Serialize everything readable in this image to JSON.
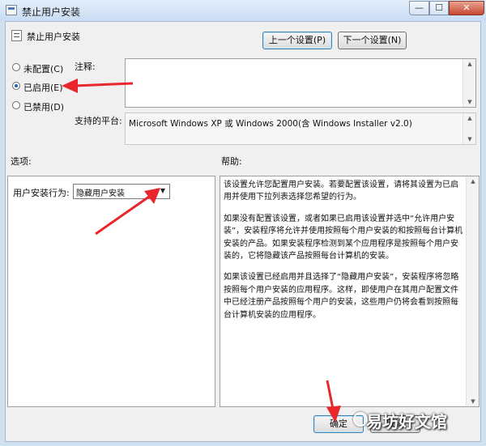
{
  "window": {
    "title": "禁止用户安装",
    "min_label": "—",
    "max_label": "☐",
    "close_label": "✕"
  },
  "header": {
    "policy_name": "禁止用户安装"
  },
  "nav": {
    "prev_label": "上一个设置(P)",
    "next_label": "下一个设置(N)"
  },
  "radios": [
    {
      "label": "未配置(C)",
      "selected": false
    },
    {
      "label": "已启用(E)",
      "selected": true
    },
    {
      "label": "已禁用(D)",
      "selected": false
    }
  ],
  "comment": {
    "label": "注释:",
    "value": ""
  },
  "platform": {
    "label": "支持的平台:",
    "value": "Microsoft Windows XP 或 Windows 2000(含 Windows Installer v2.0)"
  },
  "options": {
    "label": "选项:",
    "behavior_label": "用户安装行为:",
    "behavior_value": "隐藏用户安装"
  },
  "help": {
    "label": "帮助:",
    "paragraphs": [
      "该设置允许您配置用户安装。若要配置该设置，请将其设置为已启用并使用下拉列表选择您希望的行为。",
      "如果没有配置该设置，或者如果已启用该设置并选中“允许用户安装”，安装程序将允许并使用按照每个用户安装的和按照每台计算机安装的产品。如果安装程序检测到某个应用程序是按照每个用户安装的，它将隐藏该产品按照每台计算机的安装。",
      "如果该设置已经启用并且选择了“隐藏用户安装”，安装程序将忽略按照每个用户安装的应用程序。这样，即使用户在其用户配置文件中已经注册产品按照每个用户的安装，这些用户仍将会看到按照每台计算机安装的应用程序。"
    ]
  },
  "buttons": {
    "ok_label": "确定",
    "cancel_label": "取消"
  },
  "watermark": {
    "text": "易坊好文馆"
  },
  "colors": {
    "annotation_arrow": "#e8262b",
    "accent": "#3c7fb1"
  }
}
